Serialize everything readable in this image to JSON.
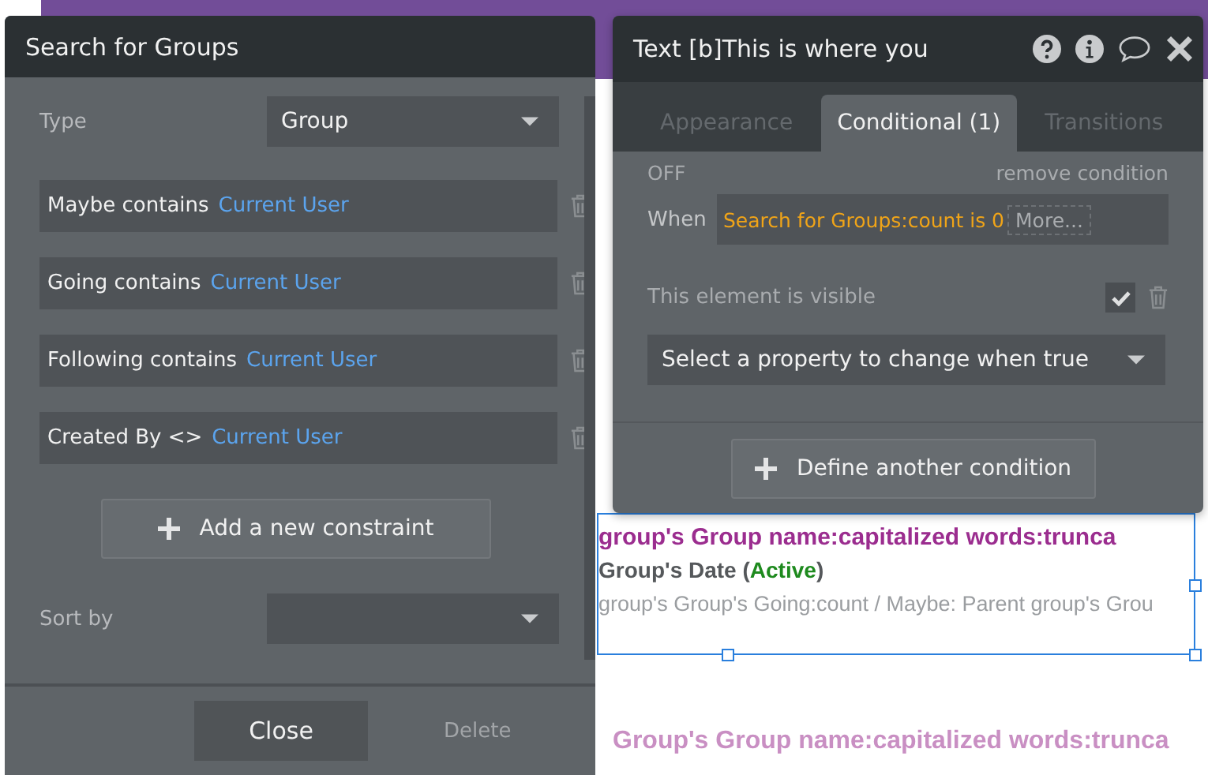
{
  "canvas": {
    "lines": [
      {
        "kind": "heading",
        "text": "group's Group name:capitalized words:trunca"
      },
      {
        "kind": "date",
        "prefix": "Group's Date (",
        "status": "Active",
        "suffix": ")"
      },
      {
        "kind": "detail",
        "text": "group's Group's Going:count / Maybe: Parent group's Grou"
      }
    ],
    "faded_line": "Group's Group name:capitalized words:trunca"
  },
  "search_panel": {
    "title": "Search for Groups",
    "type_label": "Type",
    "type_value": "Group",
    "constraints": [
      {
        "field": "Maybe contains",
        "value": "Current User"
      },
      {
        "field": "Going contains",
        "value": "Current User"
      },
      {
        "field": "Following contains",
        "value": "Current User"
      },
      {
        "field": "Created By <>",
        "value": "Current User"
      }
    ],
    "add_button": "Add a new constraint",
    "sort_label": "Sort by",
    "buttons": [
      {
        "label": "Close",
        "disabled": false
      },
      {
        "label": "Delete",
        "disabled": true
      }
    ]
  },
  "property_panel": {
    "title": "Text [b]This is where you",
    "tabs": [
      {
        "label": "Appearance",
        "selected": false
      },
      {
        "label": "Conditional (1)",
        "selected": true
      },
      {
        "label": "Transitions",
        "selected": false
      }
    ],
    "condition": {
      "state": "OFF",
      "remove_label": "remove condition",
      "when_label": "When",
      "expression": "Search for Groups:count is 0",
      "more": "More...",
      "property_label": "This element is visible",
      "checked": true,
      "select_placeholder": "Select a property to change when true"
    },
    "define_button": "Define another condition"
  }
}
